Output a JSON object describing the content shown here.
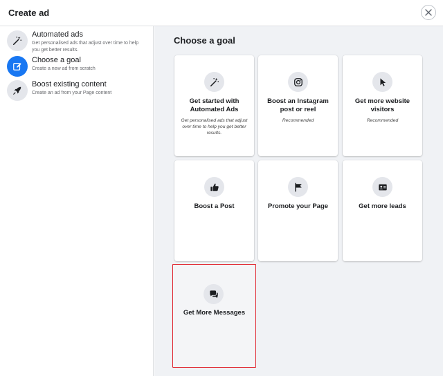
{
  "header": {
    "title": "Create ad"
  },
  "sidebar": {
    "items": [
      {
        "title": "Automated ads",
        "desc": "Get personalised ads that adjust over time to help you get better results.",
        "icon": "magic-wand-icon"
      },
      {
        "title": "Choose a goal",
        "desc": "Create a new ad from scratch",
        "icon": "edit-pencil-icon",
        "active": true
      },
      {
        "title": "Boost existing content",
        "desc": "Create an ad from your Page content",
        "icon": "rocket-icon"
      }
    ]
  },
  "main": {
    "title": "Choose a goal",
    "cards": [
      {
        "title": "Get started with Automated Ads",
        "desc": "Get personalised ads that adjust over time to help you get better results.",
        "icon": "magic-wand-icon"
      },
      {
        "title": "Boost an Instagram post or reel",
        "desc": "Recommended",
        "icon": "instagram-icon"
      },
      {
        "title": "Get more website visitors",
        "desc": "Recommended",
        "icon": "cursor-icon"
      },
      {
        "title": "Boost a Post",
        "desc": "",
        "icon": "thumbs-up-icon"
      },
      {
        "title": "Promote your Page",
        "desc": "",
        "icon": "flag-icon"
      },
      {
        "title": "Get more leads",
        "desc": "",
        "icon": "contact-card-icon"
      },
      {
        "title": "Get More Messages",
        "desc": "",
        "icon": "chat-bubbles-icon",
        "selected": true
      }
    ]
  },
  "colors": {
    "accent": "#1877f2",
    "selection": "#e0202a",
    "background": "#f0f2f5"
  }
}
